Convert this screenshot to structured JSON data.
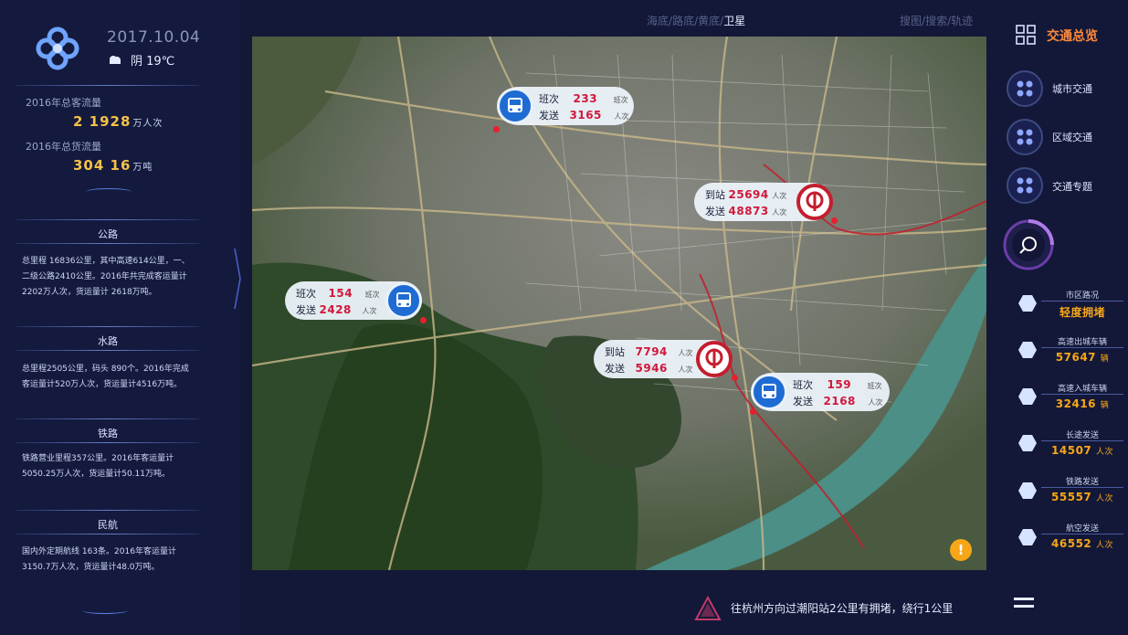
{
  "header": {
    "date": "2017.10.04",
    "weather_text": "阴 19℃",
    "top_nav_left": [
      "海底",
      "路底",
      "黄底",
      "卫星"
    ],
    "top_nav_left_active": 3,
    "top_nav_right": [
      "搜图",
      "搜索",
      "轨迹"
    ]
  },
  "stats": {
    "passenger_label": "2016年总客流量",
    "passenger_value": "2 1928",
    "passenger_unit": "万人次",
    "freight_label": "2016年总货流量",
    "freight_value": "304 16",
    "freight_unit": "万吨"
  },
  "sections": [
    {
      "title": "公路",
      "text": "总里程 16836公里，其中高速614公里，一、二级公路2410公里。2016年共完成客运量计 2202万人次，货运量计 2618万吨。"
    },
    {
      "title": "水路",
      "text": "总里程2505公里，码头 890个。2016年完成客运量计520万人次，货运量计4516万吨。"
    },
    {
      "title": "铁路",
      "text": "铁路营业里程357公里。2016年客运量计5050.25万人次，货运量计50.11万吨。"
    },
    {
      "title": "民航",
      "text": "国内外定期航线 163条。2016年客运量计3150.7万人次，货运量计48.0万吨。"
    }
  ],
  "map": {
    "callouts": [
      {
        "icon": "bus-icon",
        "l1": "班次",
        "v1": "233",
        "u1": "班次",
        "l2": "发送",
        "v2": "3165",
        "u2": "人次"
      },
      {
        "icon": "rail-icon",
        "l1": "到站",
        "v1": "25694",
        "u1": "人次",
        "l2": "发送",
        "v2": "48873",
        "u2": "人次"
      },
      {
        "icon": "bus-icon",
        "l1": "班次",
        "v1": "154",
        "u1": "班次",
        "l2": "发送",
        "v2": "2428",
        "u2": "人次"
      },
      {
        "icon": "rail-icon",
        "l1": "到站",
        "v1": "7794",
        "u1": "人次",
        "l2": "发送",
        "v2": "5946",
        "u2": "人次"
      },
      {
        "icon": "bus-icon",
        "l1": "班次",
        "v1": "159",
        "u1": "班次",
        "l2": "发送",
        "v2": "2168",
        "u2": "人次"
      }
    ]
  },
  "right": {
    "title": "交通总览",
    "nav": [
      "城市交通",
      "区域交通",
      "交通专题"
    ],
    "metrics": [
      {
        "label": "市区路况",
        "value": "轻度拥堵",
        "unit": ""
      },
      {
        "label": "高速出城车辆",
        "value": "57647",
        "unit": "辆"
      },
      {
        "label": "高速入城车辆",
        "value": "32416",
        "unit": "辆"
      },
      {
        "label": "长途发送",
        "value": "14507",
        "unit": "人次"
      },
      {
        "label": "铁路发送",
        "value": "55557",
        "unit": "人次"
      },
      {
        "label": "航空发送",
        "value": "46552",
        "unit": "人次"
      }
    ]
  },
  "alert": {
    "text": "往杭州方向过潮阳站2公里有拥堵，绕行1公里"
  },
  "colors": {
    "accent": "#f6c148",
    "orange": "#ff8a3c",
    "bus": "#1f6bd4",
    "rail": "#c41e2e",
    "background": "#131838"
  }
}
